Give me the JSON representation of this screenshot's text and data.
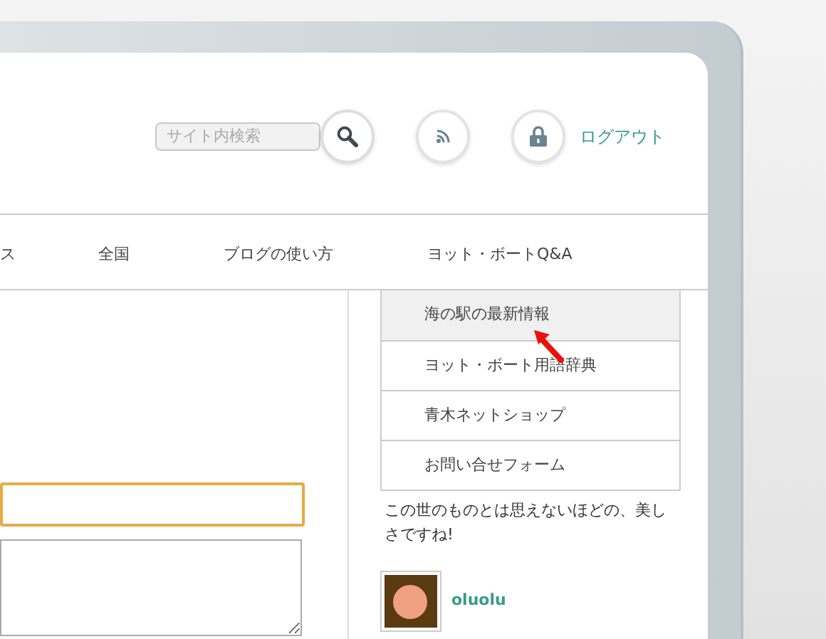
{
  "search": {
    "placeholder": "サイト内検索"
  },
  "logout": "ログアウト",
  "nav": [
    {
      "label": "ス"
    },
    {
      "label": "全国"
    },
    {
      "label": "ブログの使い方"
    },
    {
      "label": "ヨット・ボートQ&A"
    }
  ],
  "sidebar_menu": [
    {
      "label": "海の駅の最新情報",
      "selected": true
    },
    {
      "label": "ヨット・ボート用語辞典",
      "selected": false
    },
    {
      "label": "青木ネットショップ",
      "selected": false
    },
    {
      "label": "お問い合せフォーム",
      "selected": false
    }
  ],
  "comment": {
    "text": "この世のものとは思えないほどの、美しさですね!",
    "author": "oluolu"
  }
}
